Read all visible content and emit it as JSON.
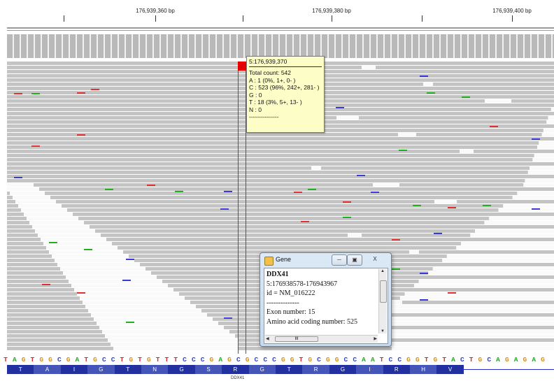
{
  "ruler": {
    "ticks": [
      {
        "label": "176,939,360 bp"
      },
      {
        "label": "176,939,380 bp"
      },
      {
        "label": "176,939,400 bp"
      }
    ]
  },
  "tooltip": {
    "title": "5:176,939,370",
    "lines": [
      "Total count: 542",
      "A : 1 (0%, 1+, 0- )",
      "C : 523 (96%, 242+, 281- )",
      "G : 0",
      "T : 18 (3%, 5+, 13- )",
      "N : 0",
      "---------------"
    ]
  },
  "gene_window": {
    "title": "Gene",
    "gene_name": "DDX41",
    "location": "5:176938578-176943967",
    "id": "id = NM_016222",
    "separator": "--------------",
    "exon": "Exon number: 15",
    "aa": "Amino acid coding number: 525",
    "hscroll_label": "III",
    "close_label": "X"
  },
  "sequence": {
    "bases": "TAGTGGCGATGCCTGTGTTTCCCGAGCGCCCGGTGCGGCCAATCCGGTGTACTGCAGAGAG",
    "colors": {
      "A": "#22a822",
      "C": "#2f45e0",
      "G": "#d6901a",
      "T": "#e0222a"
    }
  },
  "translation": {
    "residues": [
      "T",
      "A",
      "I",
      "G",
      "T",
      "N",
      "G",
      "S",
      "R",
      "G",
      "T",
      "R",
      "G",
      "I",
      "R",
      "H",
      "V"
    ],
    "colors": [
      "#2230a0",
      "#4655b8"
    ]
  },
  "gene_label_bottom": "DDX41"
}
